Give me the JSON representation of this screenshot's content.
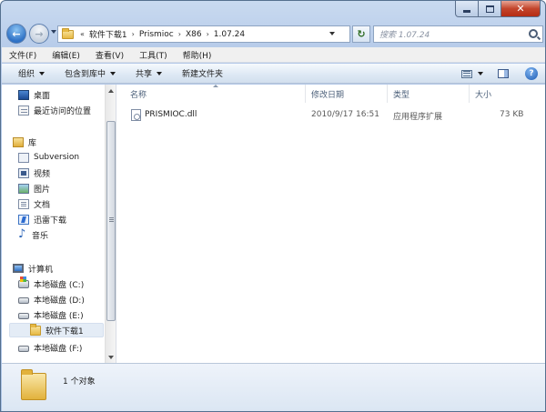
{
  "window": {
    "caption_buttons": {
      "minimize": "minimize",
      "maximize": "maximize",
      "close": "✕"
    }
  },
  "address": {
    "overflow": "«",
    "crumbs": [
      "软件下载1",
      "Prismioc",
      "X86",
      "1.07.24"
    ],
    "separator": "›"
  },
  "search": {
    "placeholder": "搜索 1.07.24"
  },
  "menubar": [
    "文件(F)",
    "编辑(E)",
    "查看(V)",
    "工具(T)",
    "帮助(H)"
  ],
  "toolbar": {
    "organize": "组织",
    "include_in_library": "包含到库中",
    "share": "共享",
    "new_folder": "新建文件夹"
  },
  "nav": {
    "favorites": [
      {
        "label": "桌面",
        "icon": "desktop-icon"
      },
      {
        "label": "最近访问的位置",
        "icon": "recent-places-icon"
      }
    ],
    "library": {
      "label": "库",
      "icon": "library-icon",
      "items": [
        {
          "label": "Subversion",
          "icon": "subversion-icon"
        },
        {
          "label": "视频",
          "icon": "video-icon"
        },
        {
          "label": "图片",
          "icon": "pictures-icon"
        },
        {
          "label": "文档",
          "icon": "documents-icon"
        },
        {
          "label": "迅雷下载",
          "icon": "thunder-download-icon"
        },
        {
          "label": "音乐",
          "icon": "music-icon"
        }
      ]
    },
    "computer": {
      "label": "计算机",
      "icon": "computer-icon",
      "items": [
        {
          "label": "本地磁盘 (C:)",
          "icon": "drive-c-icon"
        },
        {
          "label": "本地磁盘 (D:)",
          "icon": "drive-icon"
        },
        {
          "label": "本地磁盘 (E:)",
          "icon": "drive-icon"
        },
        {
          "label": "软件下载1",
          "icon": "folder-icon",
          "selected": true
        },
        {
          "label": "本地磁盘 (F:)",
          "icon": "drive-icon"
        }
      ]
    }
  },
  "columns": {
    "name": "名称",
    "date": "修改日期",
    "type": "类型",
    "size": "大小"
  },
  "files": [
    {
      "name": "PRISMIOC.dll",
      "date": "2010/9/17 16:51",
      "type": "应用程序扩展",
      "size": "73 KB"
    }
  ],
  "status": {
    "count": "1 个对象"
  }
}
